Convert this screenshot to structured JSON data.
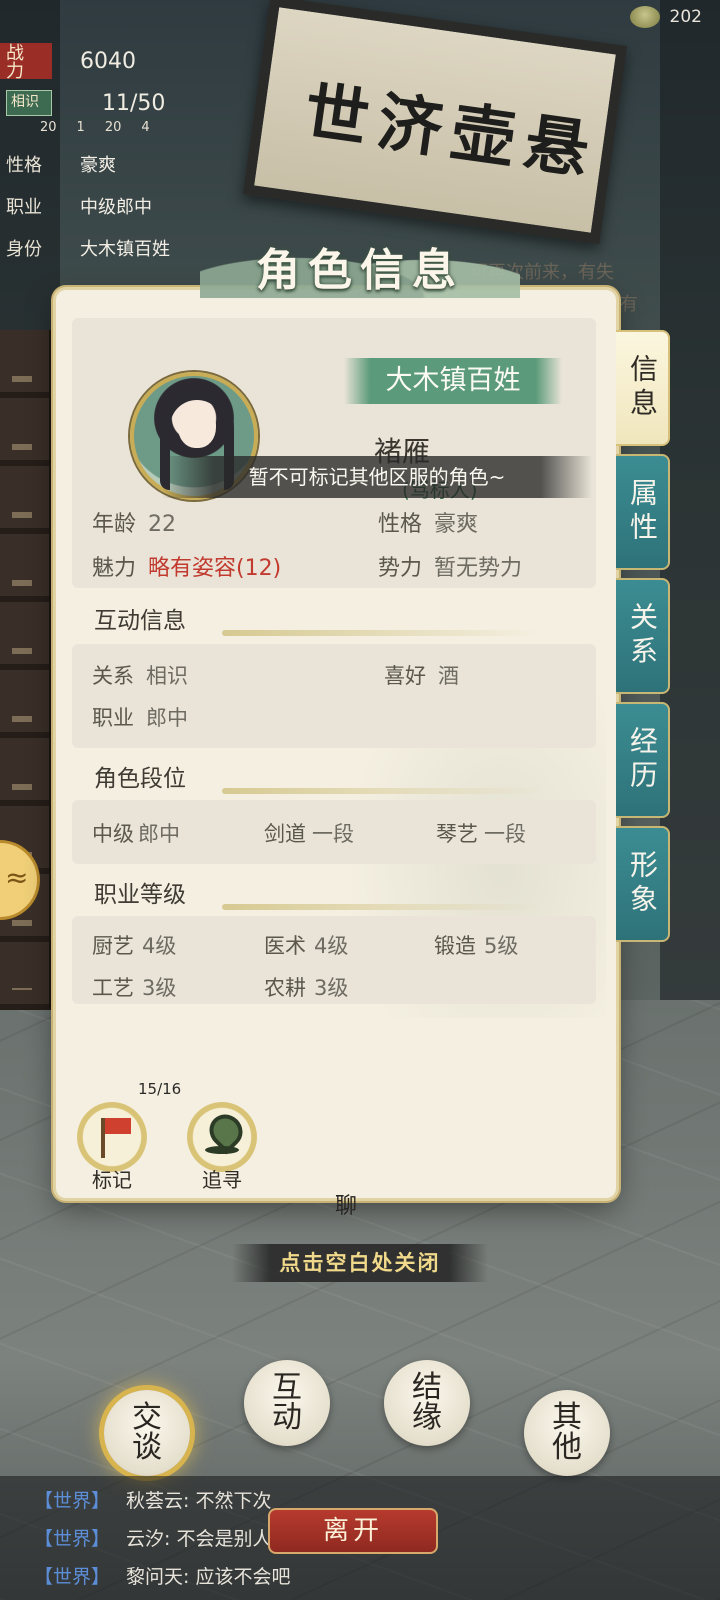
{
  "hud": {
    "currency_value": "202",
    "power_label": "战\n力",
    "power_value": "6040",
    "relation_badge": "相识",
    "relation_value": "11/50",
    "mini_items": [
      "20",
      "1",
      "20",
      "4"
    ],
    "profile": [
      {
        "key": "性格",
        "value": "豪爽"
      },
      {
        "key": "职业",
        "value": "中级郎中"
      },
      {
        "key": "身份",
        "value": "大木镇百姓"
      }
    ]
  },
  "background": {
    "signboard": "世济壶悬",
    "side_text_1": "可再次前来，有失",
    "side_text_2": "有"
  },
  "dialog": {
    "title": "角色信息",
    "npc_title": "大木镇百姓",
    "npc_name": "褚雁",
    "npc_sub": "(骂标人)",
    "toast": "暂不可标记其他区服的角色~",
    "basic": {
      "age_label": "年龄",
      "age_value": "22",
      "personality_label": "性格",
      "personality_value": "豪爽",
      "charm_label": "魅力",
      "charm_value": "略有姿容(12)",
      "faction_label": "势力",
      "faction_value": "暂无势力"
    },
    "interaction": {
      "title": "互动信息",
      "relation_label": "关系",
      "relation_value": "相识",
      "hobby_label": "喜好",
      "hobby_value": "酒",
      "job_label": "职业",
      "job_value": "郎中"
    },
    "rank": {
      "title": "角色段位",
      "items": [
        {
          "label": "中级",
          "value": "郎中"
        },
        {
          "label": "剑道",
          "value": "一段"
        },
        {
          "label": "琴艺",
          "value": "一段"
        }
      ]
    },
    "career": {
      "title": "职业等级",
      "items": [
        {
          "label": "厨艺",
          "value": "4级"
        },
        {
          "label": "医术",
          "value": "4级"
        },
        {
          "label": "锻造",
          "value": "5级"
        },
        {
          "label": "工艺",
          "value": "3级"
        },
        {
          "label": "农耕",
          "value": "3级"
        }
      ]
    },
    "mark": {
      "label": "标记",
      "count": "15/16"
    },
    "track": {
      "label": "追寻"
    },
    "tabs": [
      "信息",
      "属性",
      "关系",
      "经历",
      "形象"
    ],
    "active_tab": "信息"
  },
  "close_hint": "点击空白处关闭",
  "chat_partial_label": "聊",
  "actions": {
    "talk": "交谈",
    "interact": "互动",
    "bond": "结缘",
    "other": "其他",
    "leave": "离开"
  },
  "chat": [
    {
      "channel": "【世界】",
      "text": "秋荟云: 不然下次"
    },
    {
      "channel": "【世界】",
      "text": "云汐: 不会是别人追你，你不要了吧"
    },
    {
      "channel": "【世界】",
      "text": "黎问天: 应该不会吧"
    }
  ],
  "colors": {
    "tab_teal": "#2e7279",
    "accent_gold": "#c9ad56",
    "title_green": "#5b9a7b",
    "charm_red": "#c23a2f",
    "leave_red": "#b73a2e",
    "chat_channel_blue": "#5c8ed8"
  }
}
